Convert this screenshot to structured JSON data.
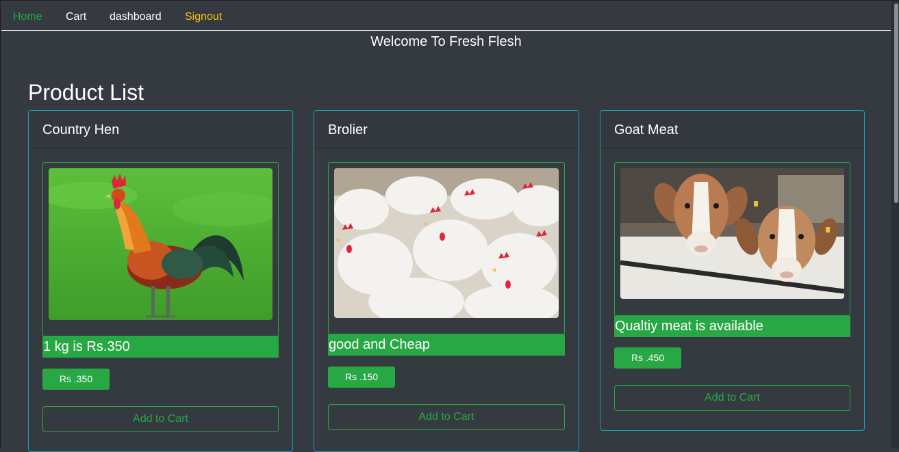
{
  "nav": {
    "home": "Home",
    "cart": "Cart",
    "dashboard": "dashboard",
    "signout": "Signout"
  },
  "welcome": "Welcome To Fresh Flesh",
  "page_title": "Product List",
  "products": [
    {
      "name": "Country Hen",
      "description": "1 kg is Rs.350",
      "price": "Rs .350",
      "cta": "Add to Cart",
      "image": "rooster-photo"
    },
    {
      "name": "Brolier",
      "description": "good and Cheap",
      "price": "Rs .150",
      "cta": "Add to Cart",
      "image": "broiler-chickens-photo"
    },
    {
      "name": "Goat Meat",
      "description": "Qualtiy meat is available",
      "price": "Rs .450",
      "cta": "Add to Cart",
      "image": "goats-photo"
    }
  ],
  "colors": {
    "background": "#343a40",
    "accent_green": "#28a745",
    "card_border": "#17a2b8",
    "signout_yellow": "#ffc107"
  }
}
